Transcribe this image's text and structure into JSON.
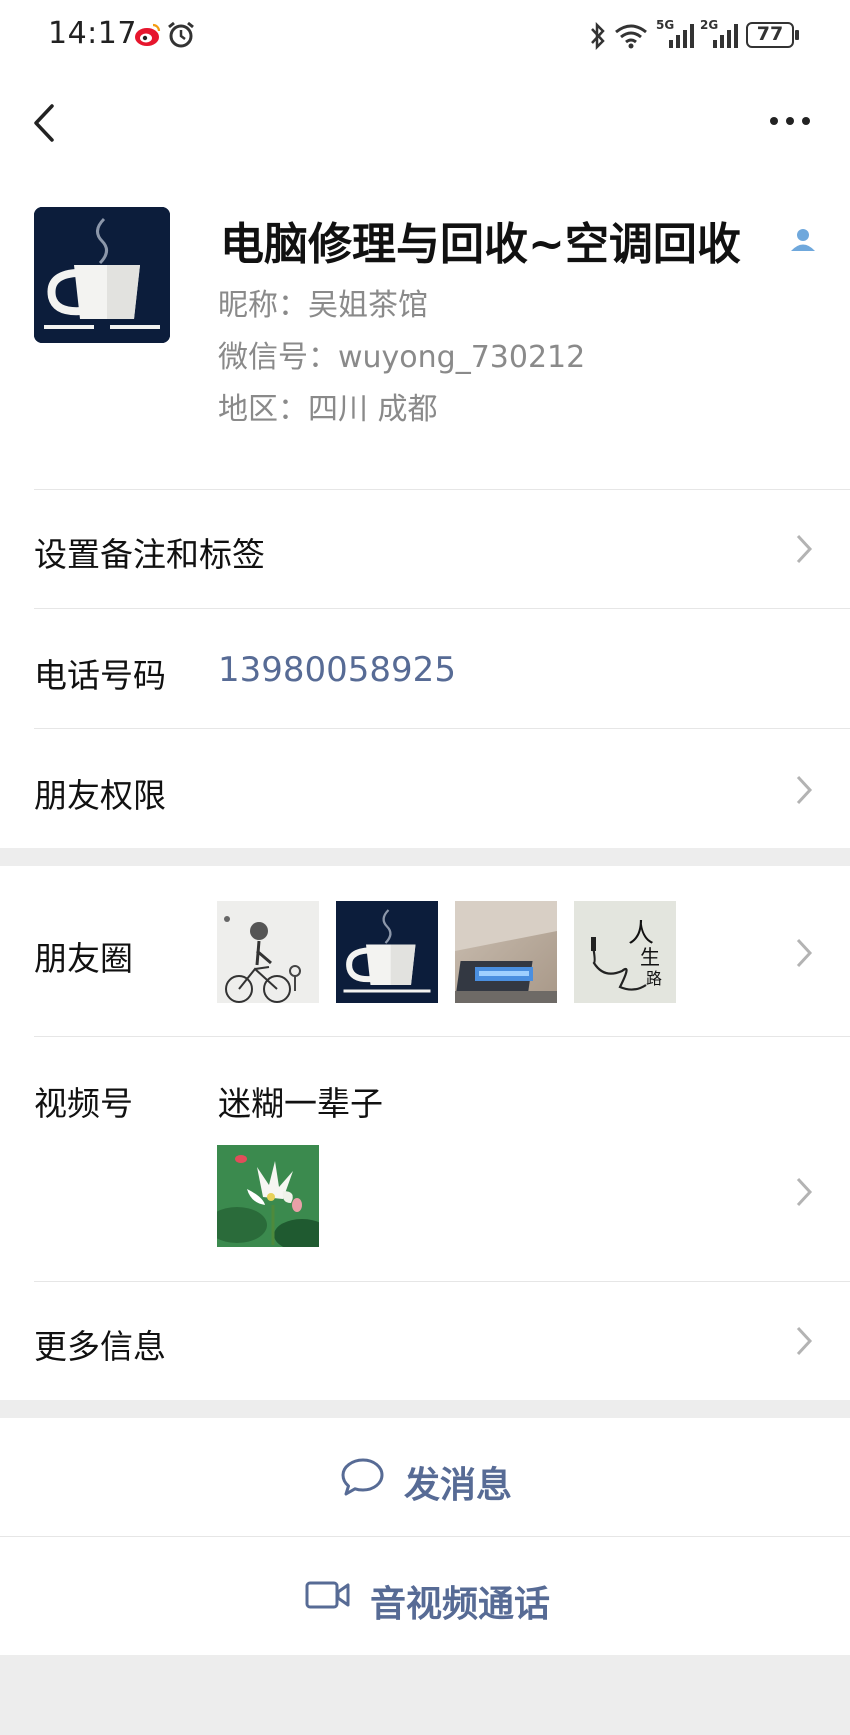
{
  "status_bar": {
    "time": "14:17",
    "network_5g": "5G",
    "network_2g": "2G",
    "battery": "77"
  },
  "profile": {
    "name": "电脑修理与回收~空调回收",
    "nickname": "昵称：吴姐茶馆",
    "wechat_id": "微信号：wuyong_730212",
    "region": "地区：四川  成都"
  },
  "rows": {
    "remark": "设置备注和标签",
    "phone_label": "电话号码",
    "phone_value": "13980058925",
    "friend_permission": "朋友权限",
    "moments": "朋友圈",
    "channels": "视频号",
    "channels_name": "迷糊一辈子",
    "more_info": "更多信息"
  },
  "moments_thumb_text": [
    "人",
    "生",
    "路"
  ],
  "actions": {
    "message": "发消息",
    "call": "音视频通话"
  },
  "colors": {
    "accent": "#576b95",
    "background_gray": "#ededed"
  }
}
